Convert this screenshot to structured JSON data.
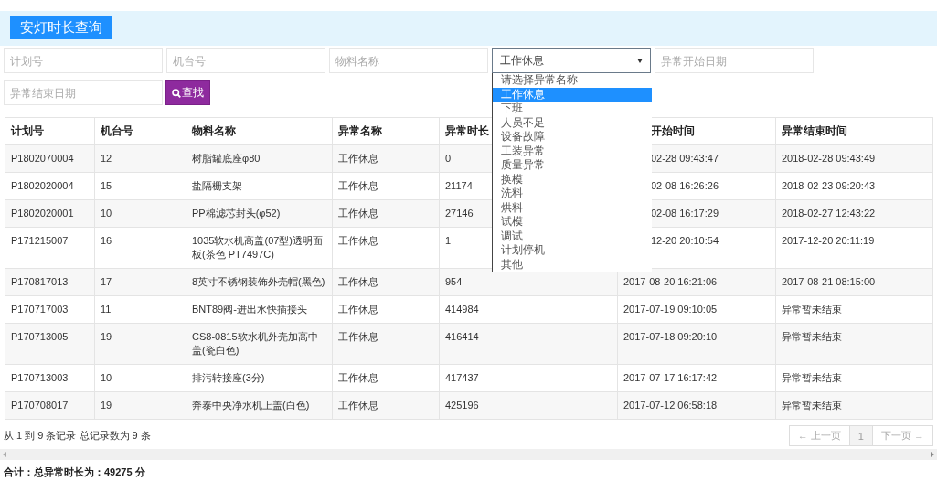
{
  "header": {
    "title": "安灯时长查询"
  },
  "filters": [
    {
      "kind": "input",
      "placeholder": "计划号"
    },
    {
      "kind": "input",
      "placeholder": "机台号"
    },
    {
      "kind": "input",
      "placeholder": "物料名称"
    },
    {
      "kind": "select",
      "value": "工作休息",
      "expanded": true,
      "options": [
        {
          "label": "请选择异常名称",
          "selected": false
        },
        {
          "label": "工作休息",
          "selected": true
        },
        {
          "label": "下班",
          "selected": false
        },
        {
          "label": "人员不足",
          "selected": false
        },
        {
          "label": "设备故障",
          "selected": false
        },
        {
          "label": "工装异常",
          "selected": false
        },
        {
          "label": "质量异常",
          "selected": false
        },
        {
          "label": "换模",
          "selected": false
        },
        {
          "label": "洗料",
          "selected": false
        },
        {
          "label": "烘料",
          "selected": false
        },
        {
          "label": "试模",
          "selected": false
        },
        {
          "label": "调试",
          "selected": false
        },
        {
          "label": "计划停机",
          "selected": false
        },
        {
          "label": "其他",
          "selected": false
        }
      ]
    },
    {
      "kind": "input",
      "placeholder": "异常开始日期"
    },
    {
      "kind": "input",
      "placeholder": "异常结束日期"
    },
    {
      "kind": "button",
      "label": "查找"
    }
  ],
  "table": {
    "columns": [
      {
        "label": "计划号",
        "covered": false
      },
      {
        "label": "机台号",
        "covered": false
      },
      {
        "label": "物料名称",
        "covered": false
      },
      {
        "label": "异常名称",
        "covered": false
      },
      {
        "label": "异常时长",
        "covered": false
      },
      {
        "label": "开始时间",
        "covered": true
      },
      {
        "label": "异常结束时间",
        "covered": false
      }
    ],
    "rows": [
      {
        "covered": true,
        "cells": [
          "P1802070004",
          "12",
          "树脂罐底座φ80",
          "工作休息",
          "0",
          "02-28 09:43:47",
          "2018-02-28 09:43:49"
        ]
      },
      {
        "covered": true,
        "cells": [
          "P1802020004",
          "15",
          "盐隔栅支架",
          "工作休息",
          "21174",
          "02-08 16:26:26",
          "2018-02-23 09:20:43"
        ]
      },
      {
        "covered": true,
        "cells": [
          "P1802020001",
          "10",
          "PP棉滤芯封头(φ52)",
          "工作休息",
          "27146",
          "02-08 16:17:29",
          "2018-02-27 12:43:22"
        ]
      },
      {
        "covered": true,
        "cells": [
          "P171215007",
          "16",
          "1035软水机高盖(07型)透明面板(茶色 PT7497C)",
          "工作休息",
          "1",
          "12-20 20:10:54",
          "2017-12-20 20:11:19"
        ]
      },
      {
        "covered": false,
        "cells": [
          "P170817013",
          "17",
          "8英寸不锈钢装饰外壳帽(黑色)",
          "工作休息",
          "954",
          "2017-08-20 16:21:06",
          "2017-08-21 08:15:00"
        ]
      },
      {
        "covered": false,
        "cells": [
          "P170717003",
          "11",
          "BNT89阀-进出水快插接头",
          "工作休息",
          "414984",
          "2017-07-19 09:10:05",
          "异常暂未结束"
        ]
      },
      {
        "covered": false,
        "cells": [
          "P170713005",
          "19",
          "CS8-0815软水机外壳加高中盖(瓷白色)",
          "工作休息",
          "416414",
          "2017-07-18 09:20:10",
          "异常暂未结束"
        ]
      },
      {
        "covered": false,
        "cells": [
          "P170713003",
          "10",
          "排污转接座(3分)",
          "工作休息",
          "417437",
          "2017-07-17 16:17:42",
          "异常暂未结束"
        ]
      },
      {
        "covered": false,
        "cells": [
          "P170708017",
          "19",
          "奔泰中央净水机上盖(白色)",
          "工作休息",
          "425196",
          "2017-07-12 06:58:18",
          "异常暂未结束"
        ]
      }
    ]
  },
  "footer": {
    "info": "从 1 到 9 条记录 总记录数为 9 条",
    "pager": [
      {
        "label": "← 上一页",
        "selected": false,
        "disabled": true
      },
      {
        "label": "1",
        "selected": true,
        "disabled": false
      },
      {
        "label": "下一页 →",
        "selected": false,
        "disabled": true
      }
    ],
    "total": "合计：总异常时长为：49275 分"
  }
}
